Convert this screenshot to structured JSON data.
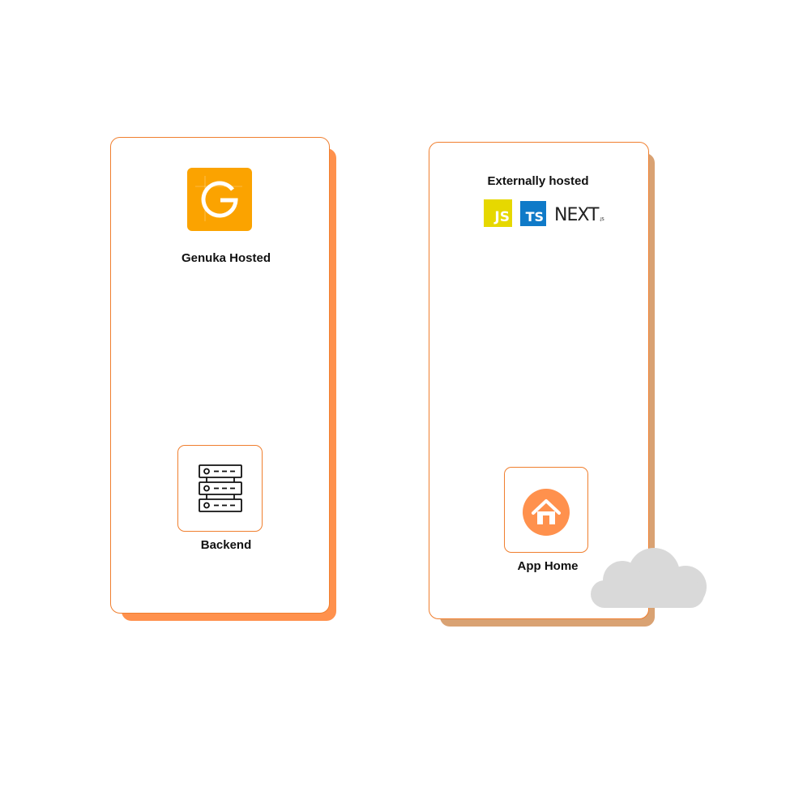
{
  "colors": {
    "accent": "#f07f2f",
    "left_shadow": "#ff914d",
    "right_shadow": "#d9a273",
    "genuka_logo": "#fba300",
    "home_icon": "#ff914d",
    "cloud": "#d9d9d9",
    "js": "#e6d800",
    "ts": "#0f7ac8"
  },
  "left_card": {
    "logo_letter": "G",
    "logo_icon": "genuka-logo-icon",
    "title": "Genuka Hosted",
    "backend": {
      "icon": "server-rack-icon",
      "label": "Backend"
    }
  },
  "right_card": {
    "title": "Externally hosted",
    "tech": {
      "js": "JS",
      "ts": "TS",
      "next": "NEXT",
      "next_suffix": ".JS"
    },
    "app_home": {
      "icon": "home-icon",
      "label": "App Home"
    }
  },
  "cloud_icon": "cloud-icon"
}
